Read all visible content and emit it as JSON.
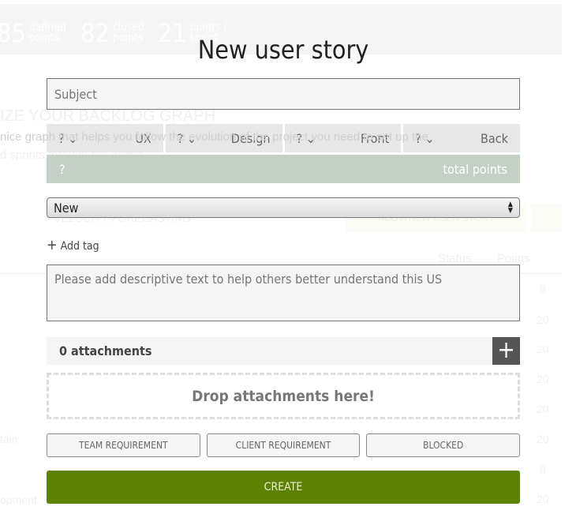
{
  "background": {
    "stats": [
      {
        "value": "85",
        "label": "defined points"
      },
      {
        "value": "82",
        "label": "closed points"
      },
      {
        "value": "21",
        "label": "points / sprint"
      }
    ],
    "graph_heading": "IZE YOUR BACKLOG GRAPH",
    "graph_text_1": "nice graph that helps you follow the evolution of the project you need to set up the",
    "graph_text_2": "d sprints through the Admin",
    "velocity": "VELOCITY FORECASTING",
    "add_story": "ADD A NEW USER STORY",
    "col_status": "Status",
    "col_points": "Points",
    "points": [
      "8",
      "20",
      "20",
      "20",
      "20",
      "20",
      "8",
      "20"
    ],
    "row_fragments": [
      "tain",
      "opment"
    ]
  },
  "modal": {
    "title": "New user story",
    "subject_placeholder": "Subject",
    "roles": [
      {
        "points": "?",
        "name": "UX"
      },
      {
        "points": "?",
        "name": "Design"
      },
      {
        "points": "?",
        "name": "Front"
      },
      {
        "points": "?",
        "name": "Back"
      }
    ],
    "total": {
      "value": "?",
      "label": "total points"
    },
    "status": "New",
    "add_tag": "Add tag",
    "description_placeholder": "Please add descriptive text to help others better understand this US",
    "attachments": "0 attachments",
    "drop": "Drop attachments here!",
    "flags": [
      "TEAM REQUIREMENT",
      "CLIENT REQUIREMENT",
      "BLOCKED"
    ],
    "create": "CREATE",
    "colors": {
      "create": "#5b8200",
      "total_bar": "#c4cfc6"
    }
  }
}
